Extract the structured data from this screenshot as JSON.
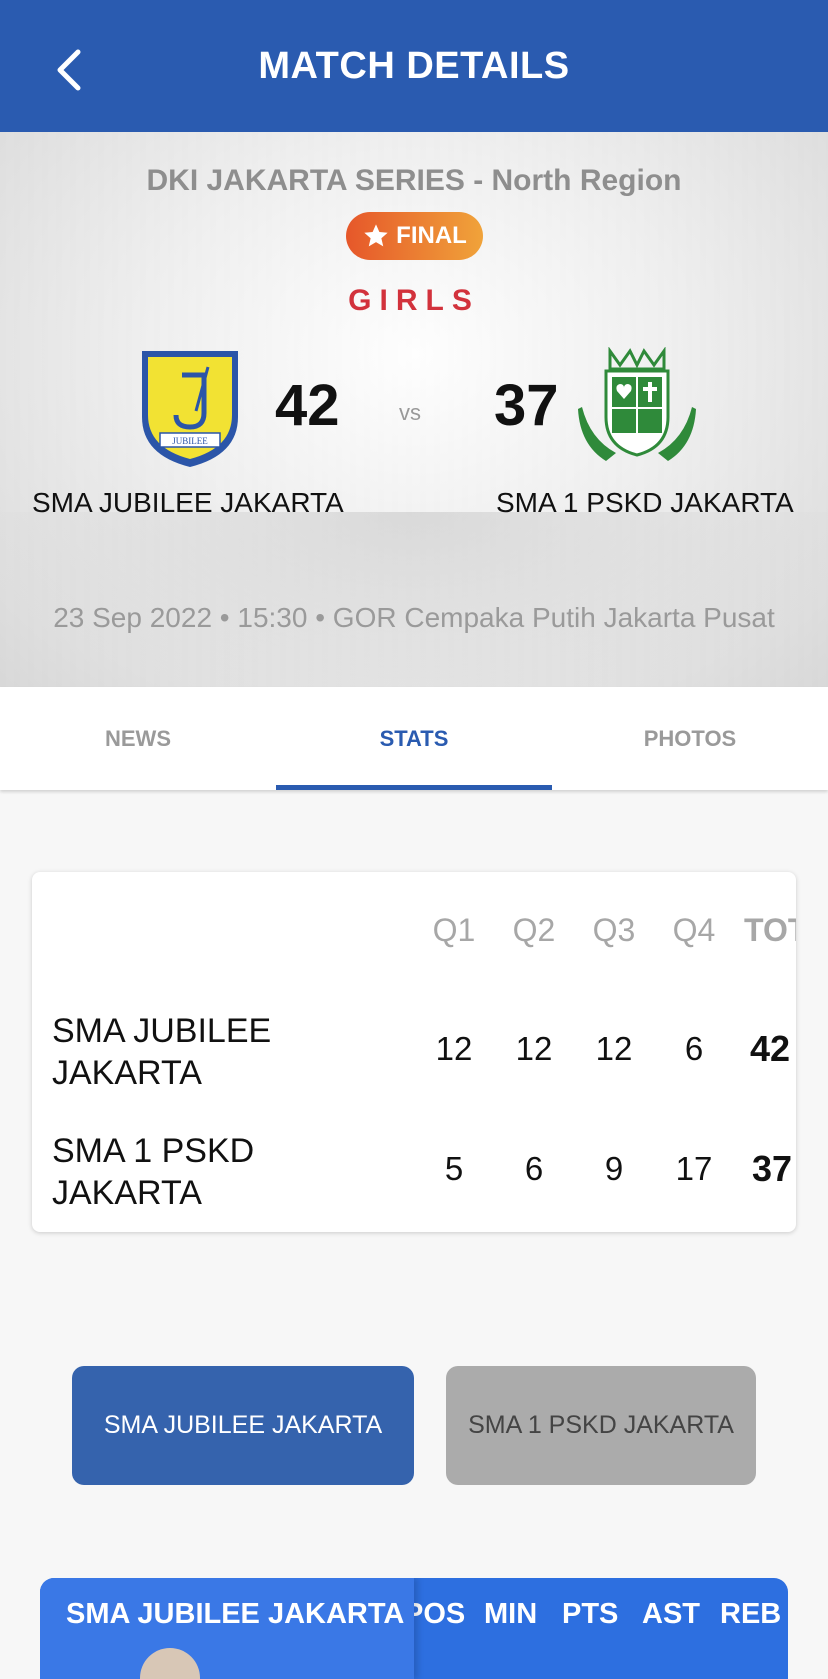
{
  "header": {
    "title": "MATCH DETAILS"
  },
  "match": {
    "series": "DKI JAKARTA SERIES - North Region",
    "stage": "FINAL",
    "category": "GIRLS",
    "vs": "vs",
    "info": "23 Sep 2022 • 15:30 • GOR Cempaka Putih Jakarta Pusat",
    "home": {
      "name": "SMA JUBILEE JAKARTA",
      "score": "42"
    },
    "away": {
      "name": "SMA 1 PSKD JAKARTA",
      "score": "37"
    }
  },
  "tabs": [
    {
      "label": "NEWS"
    },
    {
      "label": "STATS"
    },
    {
      "label": "PHOTOS"
    }
  ],
  "quarters": {
    "headers": [
      "Q1",
      "Q2",
      "Q3",
      "Q4",
      "TOT"
    ],
    "rows": [
      {
        "team": "SMA JUBILEE JAKARTA",
        "q": [
          "12",
          "12",
          "12",
          "6"
        ],
        "tot": "42"
      },
      {
        "team": "SMA 1 PSKD JAKARTA",
        "q": [
          "5",
          "6",
          "9",
          "17"
        ],
        "tot": "37"
      }
    ]
  },
  "toggle": {
    "home_label": "SMA JUBILEE JAKARTA",
    "away_label": "SMA 1 PSKD JAKARTA"
  },
  "player_stats": {
    "team_label": "SMA JUBILEE JAKARTA",
    "columns": [
      "POS",
      "MIN",
      "PTS",
      "AST",
      "REB"
    ]
  },
  "colors": {
    "primary": "#2a5bb0",
    "badge_start": "#e6572a",
    "badge_end": "#f0a33a",
    "category": "#d2323c",
    "inactive_button": "#ababab"
  }
}
